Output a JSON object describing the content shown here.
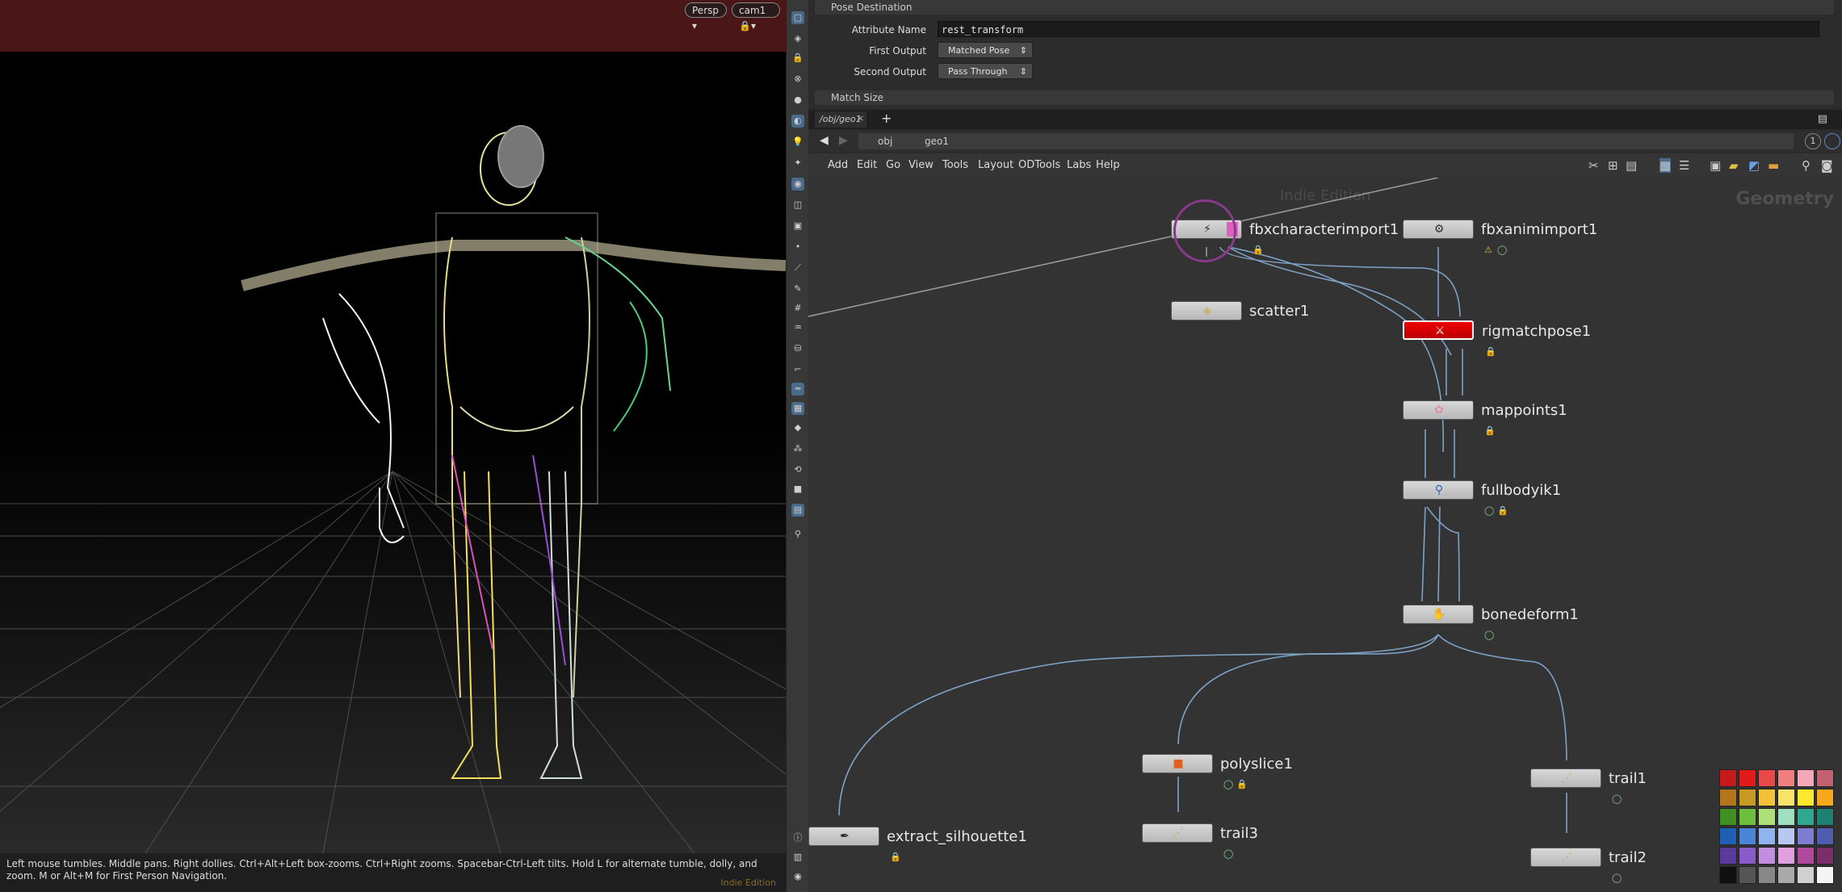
{
  "viewport": {
    "view_label": "Persp",
    "camera_label": "cam1",
    "status_text": "Left mouse tumbles. Middle pans. Right dollies. Ctrl+Alt+Left box-zooms. Ctrl+Right zooms. Spacebar-Ctrl-Left tilts. Hold L for alternate tumble, dolly, and zoom.    M or Alt+M for First Person Navigation.",
    "edition": "Indie Edition"
  },
  "params": {
    "section_pose_destination": "Pose Destination",
    "attribute_name_label": "Attribute Name",
    "attribute_name_value": "rest_transform",
    "first_output_label": "First Output",
    "first_output_value": "Matched Pose",
    "second_output_label": "Second Output",
    "second_output_value": "Pass Through",
    "section_match_size": "Match Size"
  },
  "network": {
    "tab_label": "/obj/geo1",
    "path_obj": "obj",
    "path_geo": "geo1",
    "menu": [
      "Add",
      "Edit",
      "Go",
      "View",
      "Tools",
      "Layout",
      "ODTools",
      "Labs",
      "Help"
    ],
    "watermark": "Indie Edition",
    "context_label": "Geometry",
    "page_number": "1",
    "nodes": {
      "fbxcharacterimport": "fbxcharacterimport1",
      "fbxanimimport": "fbxanimimport1",
      "scatter": "scatter1",
      "rigmatchpose": "rigmatchpose1",
      "mappoints": "mappoints1",
      "fullbodyik": "fullbodyik1",
      "bonedeform": "bonedeform1",
      "polyslice": "polyslice1",
      "trail1": "trail1",
      "trail3": "trail3",
      "trail2": "trail2",
      "extract_silhouette": "extract_silhouette1"
    }
  },
  "colors": {
    "viewport_header": "#4a1617",
    "rigmatchpose_node": "#cc0000",
    "wire": "#7fa3c7",
    "palette": [
      "#c61a1a",
      "#e11b1b",
      "#e84a4a",
      "#f08080",
      "#f4a7b9",
      "#c06070",
      "#b3761c",
      "#c99a22",
      "#f3c13a",
      "#fbe36a",
      "#ffe92e",
      "#f7a81c",
      "#3f8f25",
      "#6fbf3f",
      "#aee07a",
      "#9fe0c0",
      "#2fa88f",
      "#1e8070",
      "#1f5fb5",
      "#4a86d8",
      "#8eb5f0",
      "#b9c8f0",
      "#7c7cd0",
      "#4e5db0",
      "#5a3a9a",
      "#8a5ac8",
      "#c28ee0",
      "#e0a0e0",
      "#b04a9e",
      "#7a2e6a",
      "#101010",
      "#555555",
      "#888888",
      "#aaaaaa",
      "#d0d0d0",
      "#f5f5f5"
    ]
  }
}
